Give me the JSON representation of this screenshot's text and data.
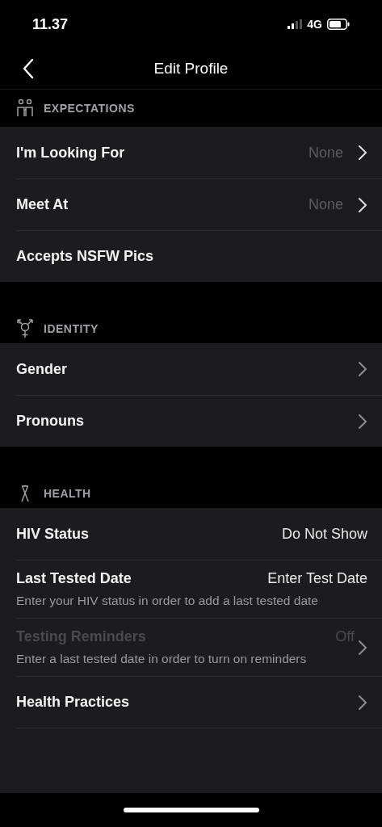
{
  "status_bar": {
    "time": "11.37",
    "network": "4G"
  },
  "nav": {
    "title": "Edit Profile"
  },
  "sections": [
    {
      "kind": "expectations",
      "title": "EXPECTATIONS",
      "rows": [
        {
          "label": "I'm Looking For",
          "value": "None",
          "value_muted": true,
          "chevron": true,
          "disabled": false
        },
        {
          "label": "Meet At",
          "value": "None",
          "value_muted": true,
          "chevron": true,
          "disabled": false
        },
        {
          "label": "Accepts NSFW Pics",
          "chevron": false,
          "disabled": false
        }
      ]
    },
    {
      "kind": "identity",
      "title": "IDENTITY",
      "rows": [
        {
          "label": "Gender",
          "chevron": true,
          "disabled": false
        },
        {
          "label": "Pronouns",
          "chevron": true,
          "disabled": false
        }
      ]
    },
    {
      "kind": "health",
      "title": "HEALTH",
      "rows": [
        {
          "label": "HIV Status",
          "value": "Do Not Show",
          "value_muted": false,
          "chevron": false,
          "disabled": false
        },
        {
          "label": "Last Tested Date",
          "value": "Enter Test Date",
          "value_muted": false,
          "hint": "Enter your HIV status in order to add a last tested date",
          "chevron": false,
          "disabled": false
        },
        {
          "label": "Testing Reminders",
          "value": "Off",
          "value_muted": true,
          "hint": "Enter a last tested date in order to turn on reminders",
          "chevron": true,
          "disabled": true
        },
        {
          "label": "Health Practices",
          "chevron": true,
          "disabled": false
        }
      ],
      "cut_row": true
    }
  ]
}
